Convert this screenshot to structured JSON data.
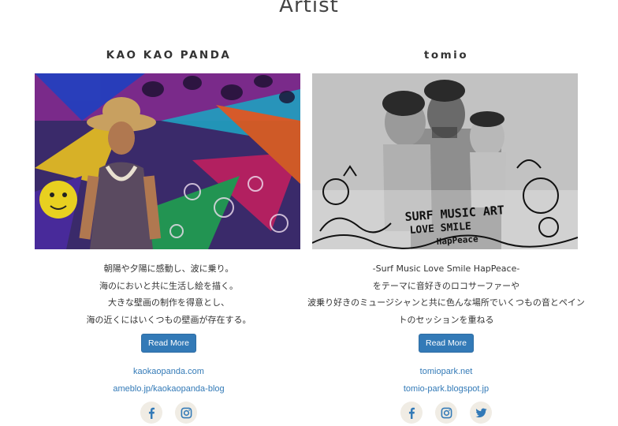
{
  "section": {
    "title": "Artist"
  },
  "artists": [
    {
      "name": "KAO KAO PANDA",
      "description": [
        "朝陽や夕陽に感動し、波に乗り。",
        "海のにおいと共に生活し絵を描く。",
        "大きな壁画の制作を得意とし、",
        "海の近くにはいくつもの壁画が存在する。"
      ],
      "button_label": "Read More",
      "links": [
        "kaokaopanda.com",
        "ameblo.jp/kaokaopanda-blog"
      ],
      "social": [
        "facebook-icon",
        "instagram-icon"
      ]
    },
    {
      "name": "tomio",
      "description": [
        "-Surf Music Love Smile HapPeace-",
        "をテーマに音好きのロコサーファーや",
        "波乗り好きのミュージシャンと共に色んな場所でいくつもの音とペイン",
        "トのセッションを重ねる"
      ],
      "photo_text": [
        "SURF MUSIC ART",
        "LOVE SMILE",
        "HapPeace"
      ],
      "button_label": "Read More",
      "links": [
        "tomiopark.net",
        "tomio-park.blogspot.jp"
      ],
      "social": [
        "facebook-icon",
        "instagram-icon",
        "twitter-icon"
      ]
    }
  ],
  "colors": {
    "link": "#337ab7",
    "button": "#337ab7",
    "social_bg": "#f0ece4"
  }
}
